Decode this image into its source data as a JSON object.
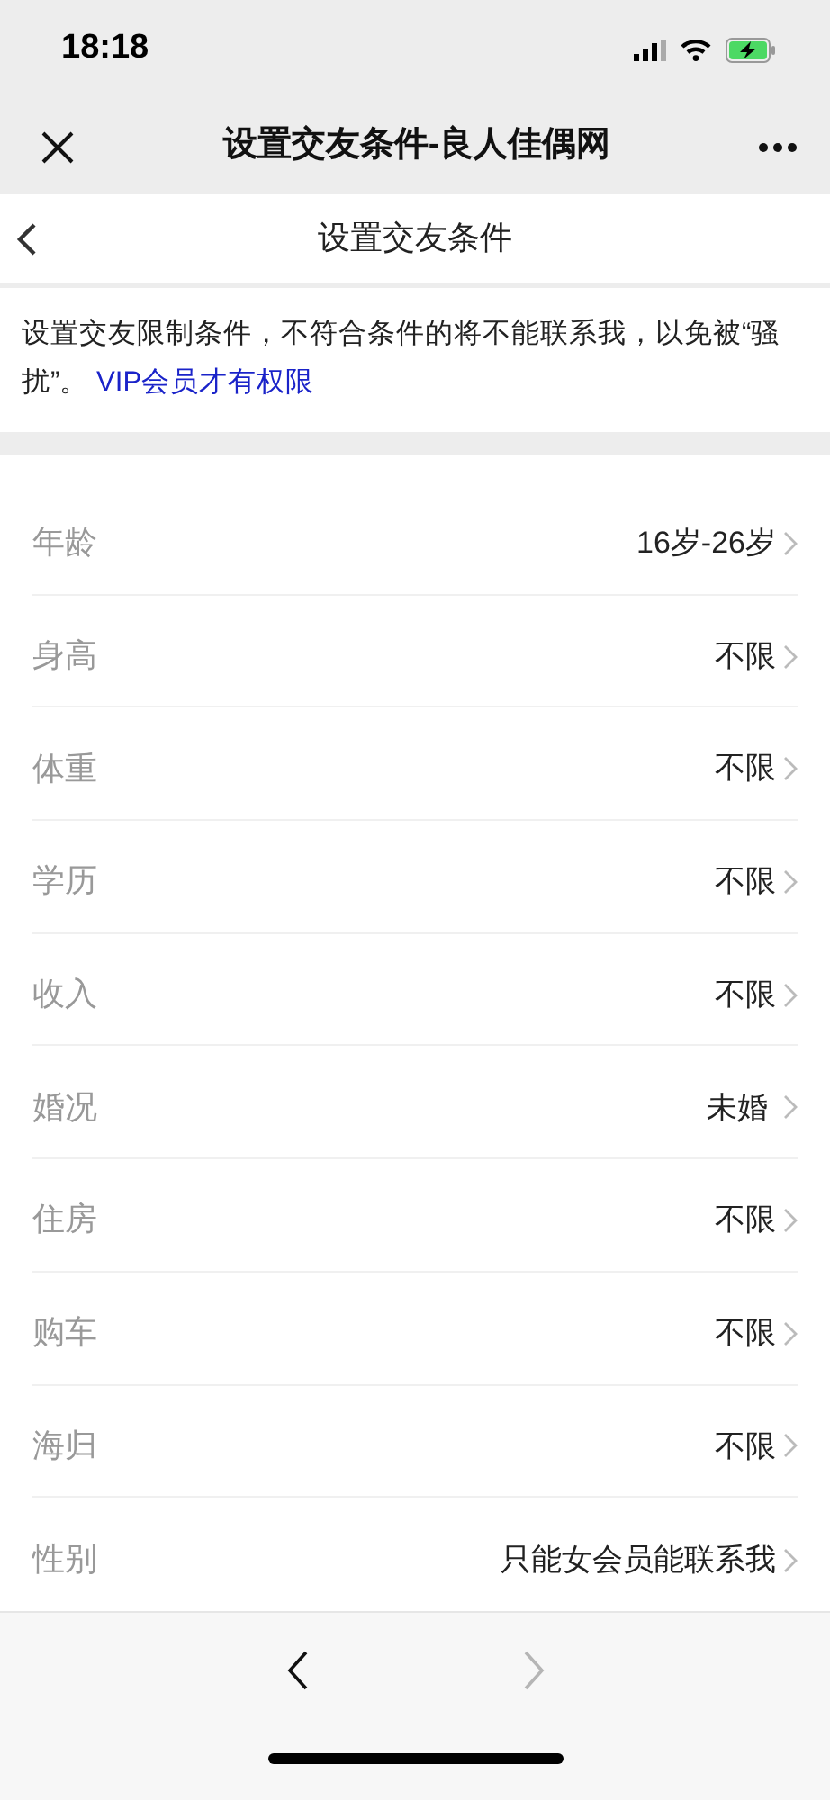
{
  "status_bar": {
    "time": "18:18"
  },
  "browser_bar": {
    "title": "设置交友条件-良人佳偶网"
  },
  "page_header": {
    "title": "设置交友条件"
  },
  "notice": {
    "text": "设置交友限制条件，不符合条件的将不能联系我，以免被“骚扰”。",
    "link": "VIP会员才有权限"
  },
  "conditions": [
    {
      "label": "年龄",
      "value": "16岁-26岁"
    },
    {
      "label": "身高",
      "value": "不限"
    },
    {
      "label": "体重",
      "value": "不限"
    },
    {
      "label": "学历",
      "value": "不限"
    },
    {
      "label": "收入",
      "value": "不限"
    },
    {
      "label": "婚况",
      "value": "未婚 "
    },
    {
      "label": "住房",
      "value": "不限"
    },
    {
      "label": "购车",
      "value": "不限"
    },
    {
      "label": "海归",
      "value": "不限"
    },
    {
      "label": "性别",
      "value": "只能女会员能联系我"
    }
  ],
  "toolbar": {
    "back": {
      "disabled": false
    },
    "forward": {
      "disabled": true
    }
  }
}
